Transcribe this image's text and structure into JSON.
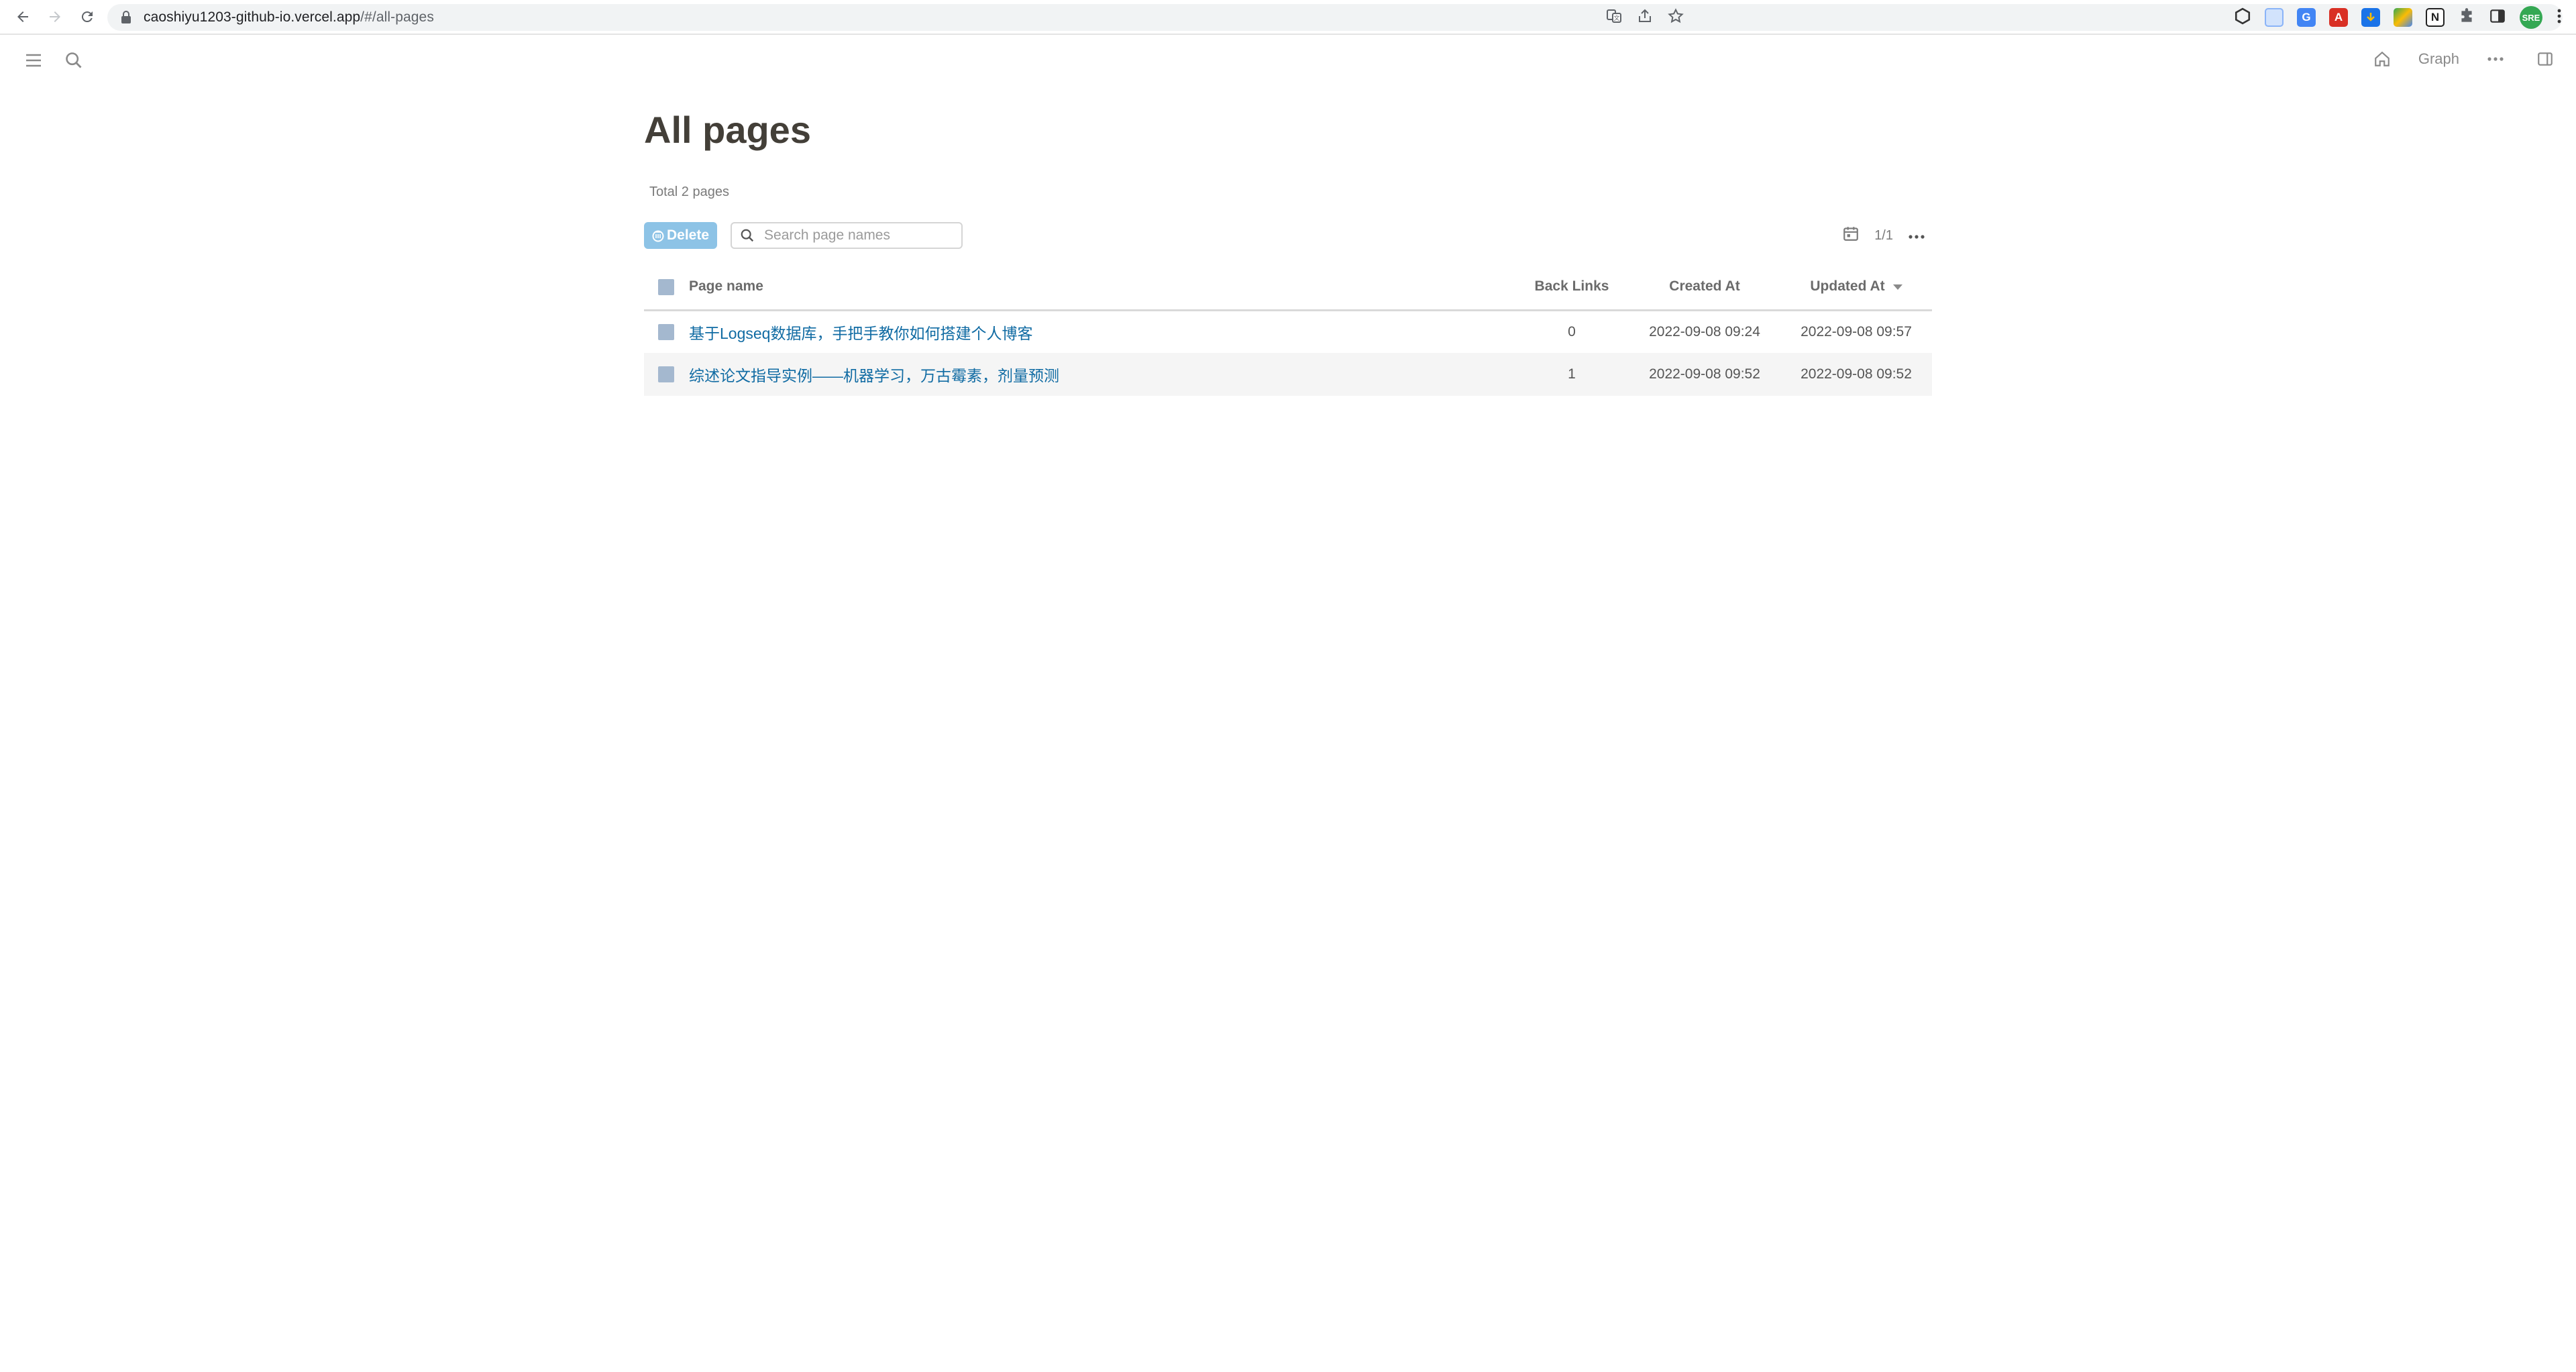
{
  "browser": {
    "url_host": "caoshiyu1203-github-io.vercel.app",
    "url_path": "/#/all-pages",
    "avatar_text": "SRE"
  },
  "header": {
    "graph_label": "Graph"
  },
  "main": {
    "title": "All pages",
    "total_text": "Total 2 pages",
    "delete_label": "Delete",
    "search_placeholder": "Search page names",
    "pagination": "1/1",
    "columns": {
      "page_name": "Page name",
      "back_links": "Back Links",
      "created_at": "Created At",
      "updated_at": "Updated At"
    },
    "rows": [
      {
        "name": "基于Logseq数据库，手把手教你如何搭建个人博客",
        "back_links": "0",
        "created_at": "2022-09-08 09:24",
        "updated_at": "2022-09-08 09:57"
      },
      {
        "name": "综述论文指导实例——机器学习，万古霉素，剂量预测",
        "back_links": "1",
        "created_at": "2022-09-08 09:52",
        "updated_at": "2022-09-08 09:52"
      }
    ]
  },
  "colors": {
    "link": "#106ba3",
    "delete_button_bg": "#8dc3e6",
    "checkbox": "#a4b8cf",
    "title": "#433f38"
  }
}
